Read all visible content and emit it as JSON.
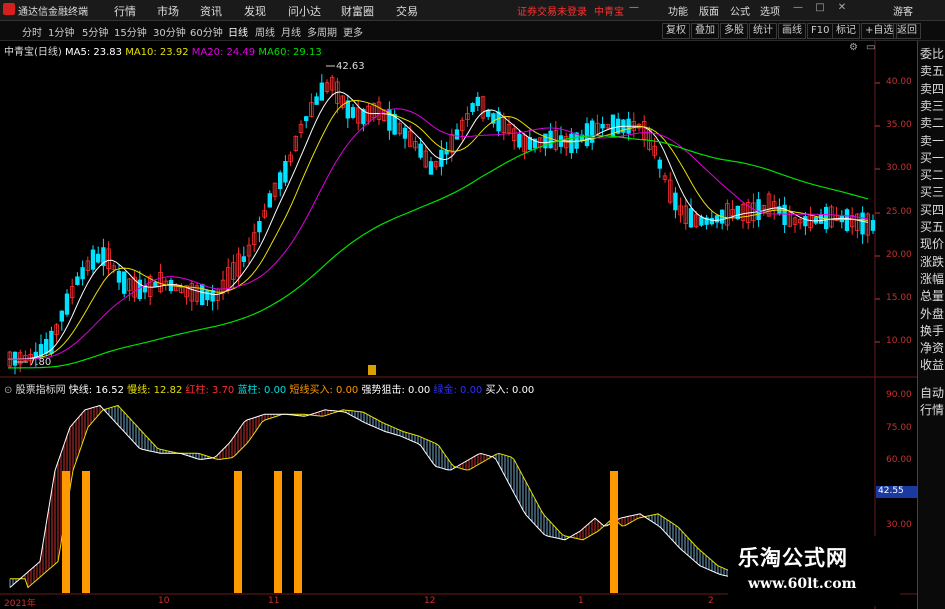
{
  "titlebar": {
    "app_name": "通达信金融终端",
    "menus": [
      "行情",
      "市场",
      "资讯",
      "发现",
      "问小达",
      "财富圈",
      "交易"
    ],
    "warning": "证券交易未登录",
    "brand": "中青宝",
    "right_menus": [
      "功能",
      "版面",
      "公式",
      "选项"
    ],
    "guest": "游客"
  },
  "toolbar": {
    "periods": [
      "分时",
      "1分钟",
      "5分钟",
      "15分钟",
      "30分钟",
      "60分钟",
      "日线",
      "周线",
      "月线",
      "多周期",
      "更多"
    ],
    "active_period": "日线",
    "buttons": [
      "复权",
      "叠加",
      "多股",
      "统计",
      "画线",
      "F10",
      "标记",
      "+自选",
      "返回"
    ]
  },
  "main_chart": {
    "title": "中青宝(日线)",
    "ma_labels": [
      {
        "text": "MA5: 23.83",
        "color": "#ffffff"
      },
      {
        "text": "MA10: 23.92",
        "color": "#e8e000"
      },
      {
        "text": "MA20: 24.49",
        "color": "#e000e0"
      },
      {
        "text": "MA60: 29.13",
        "color": "#00e000"
      }
    ],
    "high_label": "42.63",
    "low_label": "7.80",
    "marker": "●",
    "price_axis": [
      "40.00",
      "35.00",
      "30.00",
      "25.00",
      "20.00",
      "15.00",
      "10.00"
    ]
  },
  "sub_chart": {
    "title": "股票指标网",
    "labels": [
      {
        "text": "快线: 16.52",
        "color": "#ffffff"
      },
      {
        "text": "慢线: 12.82",
        "color": "#e8e000"
      },
      {
        "text": "红柱: 3.70",
        "color": "#ff3030"
      },
      {
        "text": "蓝柱: 0.00",
        "color": "#00e0e0"
      },
      {
        "text": "短线买入: 0.00",
        "color": "#ff9900"
      },
      {
        "text": "强势狙击: 0.00",
        "color": "#ffffff"
      },
      {
        "text": "绿金: 0.00",
        "color": "#3030ff"
      },
      {
        "text": "买入: 0.00",
        "color": "#ffffff"
      }
    ],
    "axis": [
      "90.00",
      "75.00",
      "60.00",
      "45.00",
      "30.00"
    ],
    "current_value": "42.55"
  },
  "x_axis": [
    "2021年",
    "10",
    "11",
    "12",
    "1",
    "2"
  ],
  "right_panel": [
    "委比",
    "卖五",
    "卖四",
    "卖三",
    "卖二",
    "卖一",
    "买一",
    "买二",
    "买三",
    "买四",
    "买五",
    "现价",
    "涨跌",
    "涨幅",
    "总量",
    "外盘",
    "换手",
    "净资",
    "收益"
  ],
  "right_panel_sub": [
    "自动",
    "行情"
  ],
  "watermark": {
    "title": "乐淘公式网",
    "url": "www.60lt.com"
  },
  "colors": {
    "up": "#ff3030",
    "down": "#00e0ff",
    "ma5": "#ffffff",
    "ma10": "#e8e000",
    "ma20": "#e000e0",
    "ma60": "#00e000",
    "signal_bar": "#ff9900"
  }
}
